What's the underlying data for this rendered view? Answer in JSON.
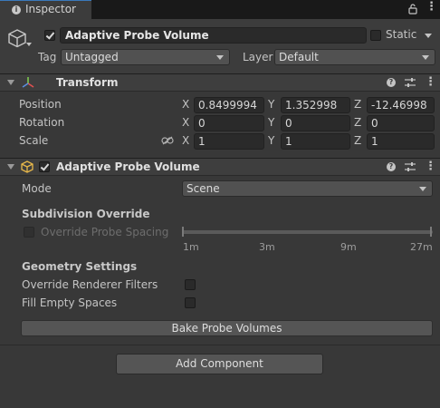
{
  "tab": {
    "title": "Inspector"
  },
  "gameobject": {
    "active": true,
    "name": "Adaptive Probe Volume",
    "static_label": "Static",
    "tag_label": "Tag",
    "tag_value": "Untagged",
    "layer_label": "Layer",
    "layer_value": "Default"
  },
  "transform": {
    "title": "Transform",
    "rows": [
      {
        "label": "Position",
        "x": "0.8499994",
        "y": "1.352998",
        "z": "-12.46998"
      },
      {
        "label": "Rotation",
        "x": "0",
        "y": "0",
        "z": "0"
      },
      {
        "label": "Scale",
        "x": "1",
        "y": "1",
        "z": "1"
      }
    ],
    "axes": {
      "x": "X",
      "y": "Y",
      "z": "Z"
    }
  },
  "apv": {
    "title": "Adaptive Probe Volume",
    "enabled": true,
    "mode_label": "Mode",
    "mode_value": "Scene",
    "subdivision_header": "Subdivision Override",
    "override_spacing_label": "Override Probe Spacing",
    "spacing_ticks": [
      "1m",
      "3m",
      "9m",
      "27m"
    ],
    "geometry_header": "Geometry Settings",
    "override_renderer_label": "Override Renderer Filters",
    "fill_empty_label": "Fill Empty Spaces",
    "bake_button": "Bake Probe Volumes"
  },
  "add_component_button": "Add Component",
  "colors": {
    "tab_accent": "#3a79bb",
    "background": "#383838"
  }
}
